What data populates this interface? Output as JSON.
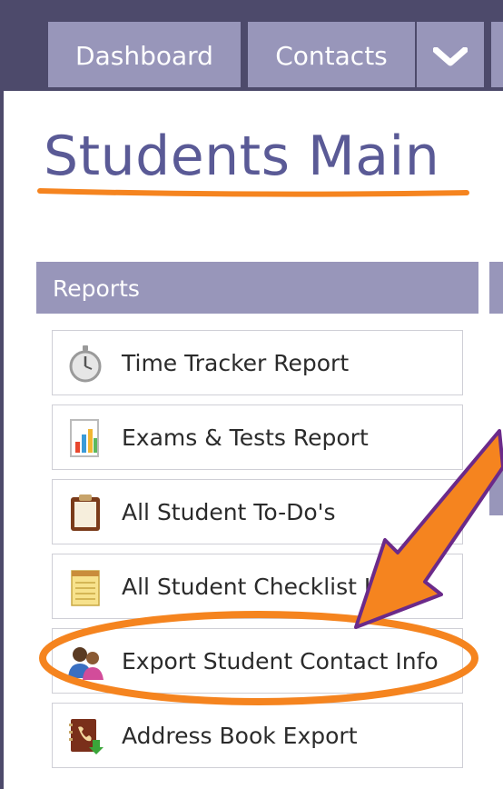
{
  "nav": {
    "tabs": [
      {
        "label": "Dashboard"
      },
      {
        "label": "Contacts"
      }
    ],
    "more_icon": "chevron-down-icon"
  },
  "page": {
    "title": "Students Main"
  },
  "reports": {
    "header": "Reports",
    "items": [
      {
        "label": "Time Tracker Report",
        "icon": "stopwatch-icon"
      },
      {
        "label": "Exams & Tests Report",
        "icon": "bar-chart-document-icon"
      },
      {
        "label": "All Student To-Do's",
        "icon": "clipboard-icon"
      },
      {
        "label": "All Student Checklist Items",
        "icon": "notepad-icon"
      },
      {
        "label": "Export Student Contact Info",
        "icon": "people-icon"
      },
      {
        "label": "Address Book Export",
        "icon": "address-book-export-icon"
      }
    ]
  },
  "annotation": {
    "accent": "#f5841f",
    "arrow_outline": "#6b2a8a"
  }
}
